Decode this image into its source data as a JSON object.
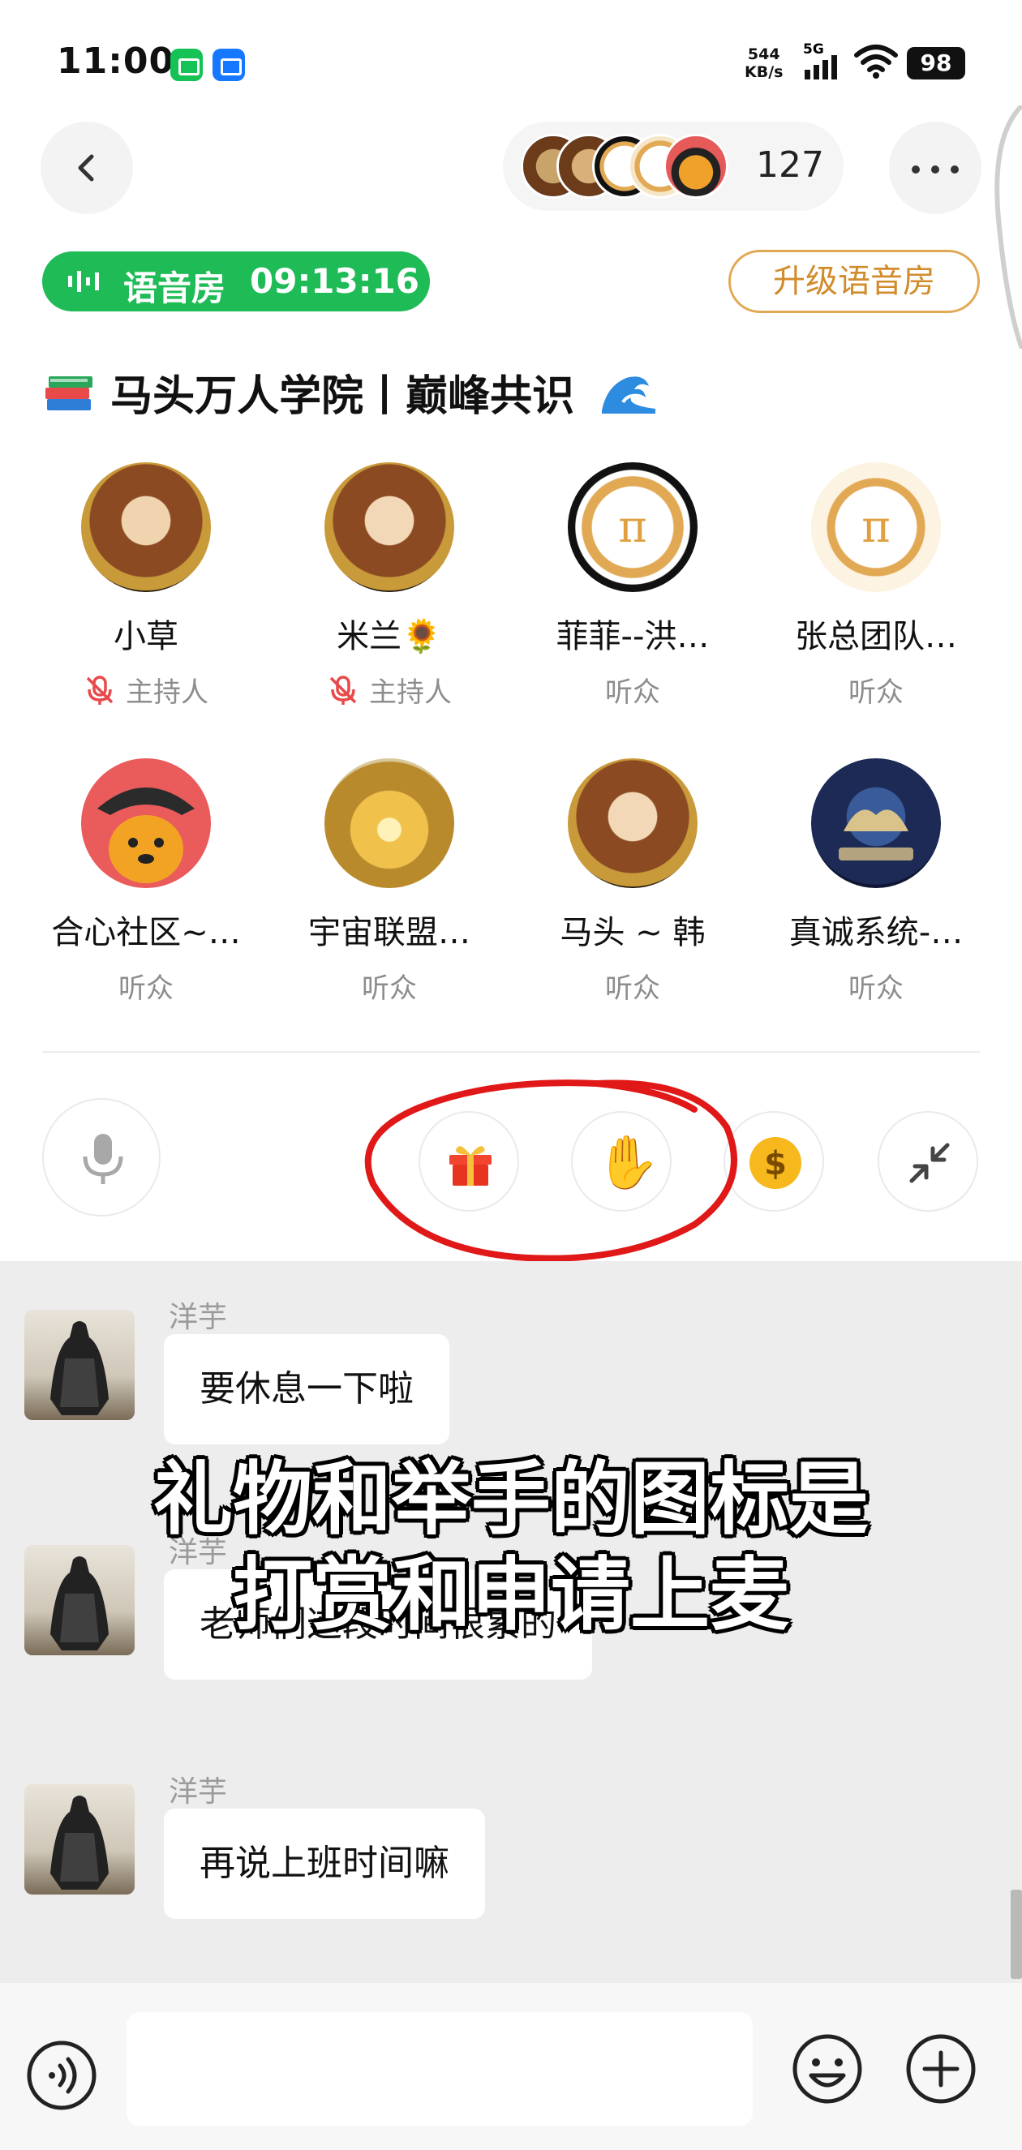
{
  "status_bar": {
    "time": "11:00",
    "net_speed_value": "544",
    "net_speed_unit": "KB/s",
    "network": "5G",
    "battery": "98"
  },
  "header": {
    "listener_count": "127",
    "voice_badge_label": "语音房",
    "voice_badge_timer": "09:13:16",
    "upgrade_label": "升级语音房",
    "room_title": "马头万人学院丨巅峰共识"
  },
  "members": [
    {
      "name": "小草",
      "role": "主持人",
      "muted": true
    },
    {
      "name": "米兰🌻",
      "role": "主持人",
      "muted": true
    },
    {
      "name": "菲菲--洪…",
      "role": "听众",
      "muted": false
    },
    {
      "name": "张总团队…",
      "role": "听众",
      "muted": false
    },
    {
      "name": "合心社区~…",
      "role": "听众",
      "muted": false
    },
    {
      "name": "宇宙联盟…",
      "role": "听众",
      "muted": false
    },
    {
      "name": "马头 ~ 韩",
      "role": "听众",
      "muted": false
    },
    {
      "name": "真诚系统-…",
      "role": "听众",
      "muted": false
    }
  ],
  "coin_icon_glyph": "$",
  "chat": [
    {
      "user": "洋芋",
      "text": "要休息一下啦"
    },
    {
      "user": "洋芋",
      "text": "老师们这段时间很累的"
    },
    {
      "user": "洋芋",
      "text": "再说上班时间嘛"
    }
  ],
  "caption": {
    "line1": "礼物和举手的图标是",
    "line2": "打赏和申请上麦"
  },
  "input": {
    "placeholder": ""
  },
  "colors": {
    "accent_green": "#1fbb57",
    "upgrade_gold": "#d18b2b",
    "annotation_red": "#e01818"
  }
}
